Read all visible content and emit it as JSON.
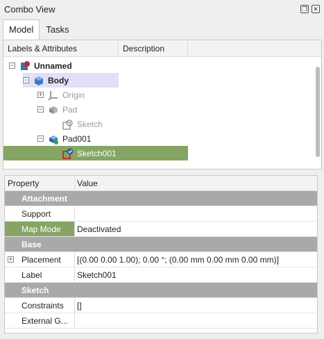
{
  "window": {
    "title": "Combo View"
  },
  "tabs": [
    {
      "label": "Model"
    },
    {
      "label": "Tasks"
    }
  ],
  "tree": {
    "headers": {
      "labels": "Labels & Attributes",
      "description": "Description"
    },
    "items": [
      {
        "label": "Unnamed",
        "expander": "−"
      },
      {
        "label": "Body",
        "expander": "−"
      },
      {
        "label": "Origin",
        "expander": "+"
      },
      {
        "label": "Pad",
        "expander": "−"
      },
      {
        "label": "Sketch"
      },
      {
        "label": "Pad001",
        "expander": "−"
      },
      {
        "label": "Sketch001"
      }
    ]
  },
  "properties": {
    "headers": {
      "property": "Property",
      "value": "Value"
    },
    "rows": [
      {
        "name": "Attachment",
        "value": ""
      },
      {
        "name": "Support",
        "value": ""
      },
      {
        "name": "Map Mode",
        "value": "Deactivated"
      },
      {
        "name": "Base",
        "value": ""
      },
      {
        "name": "Placement",
        "value": "[(0.00 0.00 1.00); 0.00 °; (0.00 mm  0.00 mm  0.00 mm)]",
        "expander": "+"
      },
      {
        "name": "Label",
        "value": "Sketch001"
      },
      {
        "name": "Sketch",
        "value": ""
      },
      {
        "name": "Constraints",
        "value": "[]"
      },
      {
        "name": "External G...",
        "value": ""
      }
    ]
  },
  "colors": {
    "selected": "#85a564",
    "body_highlight": "#e0e0f8",
    "group": "#a9a9a9"
  }
}
